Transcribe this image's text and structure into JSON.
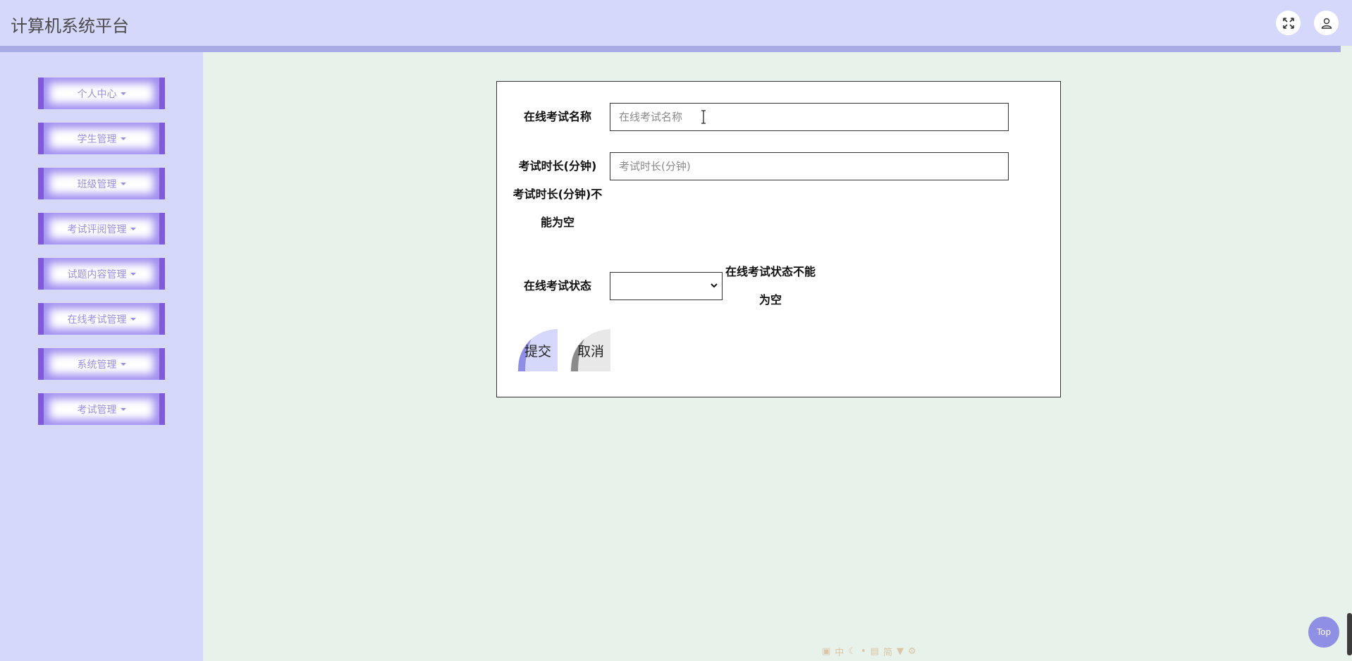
{
  "header": {
    "title": "计算机系统平台",
    "fullscreen_icon": "expand-arrows-icon",
    "user_icon": "user-icon"
  },
  "sidebar": {
    "items": [
      {
        "label": "个人中心"
      },
      {
        "label": "学生管理"
      },
      {
        "label": "班级管理"
      },
      {
        "label": "考试评阅管理"
      },
      {
        "label": "试题内容管理"
      },
      {
        "label": "在线考试管理"
      },
      {
        "label": "系统管理"
      },
      {
        "label": "考试管理"
      }
    ]
  },
  "form": {
    "name_label": "在线考试名称",
    "name_placeholder": "在线考试名称",
    "name_value": "",
    "duration_label": "考试时长(分钟)",
    "duration_placeholder": "考试时长(分钟)",
    "duration_value": "",
    "duration_error_line1": "考试时长(分钟)不",
    "duration_error_line2": "能为空",
    "status_label": "在线考试状态",
    "status_value": "",
    "status_error_line1": "在线考试状态不能",
    "status_error_line2": "为空",
    "submit_label": "提交",
    "cancel_label": "取消"
  },
  "floating": {
    "top_label": "Top"
  },
  "ime_toolbar": {
    "items": [
      "中",
      "简"
    ]
  },
  "colors": {
    "header_bg": "#d5d7fb",
    "header_strip": "#a9abe6",
    "main_bg": "#e6f2ea",
    "menu_accent": "#7f5ad9",
    "menu_text": "#9c8ee4",
    "top_button": "#8f8fe6"
  }
}
